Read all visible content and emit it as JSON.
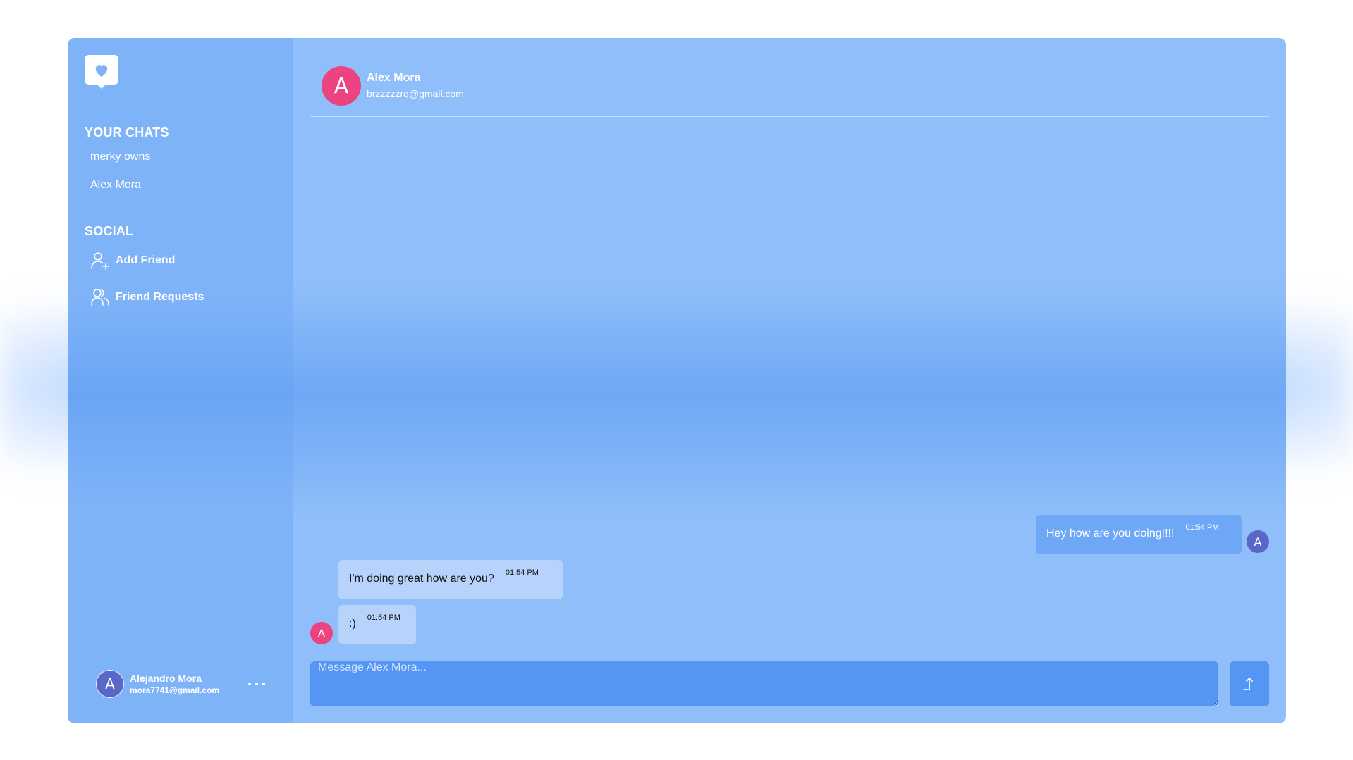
{
  "sidebar": {
    "chats_title": "YOUR CHATS",
    "chats": [
      {
        "label": "merky owns"
      },
      {
        "label": "Alex Mora"
      }
    ],
    "social_title": "SOCIAL",
    "social": [
      {
        "label": "Add Friend",
        "icon": "user-plus-icon"
      },
      {
        "label": "Friend Requests",
        "icon": "users-icon"
      }
    ],
    "profile": {
      "initial": "A",
      "name": "Alejandro Mora",
      "email": "mora7741@gmail.com"
    }
  },
  "chat": {
    "header": {
      "initial": "A",
      "name": "Alex Mora",
      "email": "brzzzzzrq@gmail.com"
    },
    "messages": [
      {
        "text": "Hey how are you doing!!!!",
        "time": "01:54 PM",
        "direction": "sent",
        "avatar": "A"
      },
      {
        "text": "I'm doing great how are you?",
        "time": "01:54 PM",
        "direction": "received"
      },
      {
        "text": ":)",
        "time": "01:54 PM",
        "direction": "received",
        "avatar": "A"
      }
    ],
    "composer_placeholder": "Message Alex Mora..."
  },
  "colors": {
    "accent": "#5595f4",
    "sent_bubble": "#6ea7f5",
    "received_bubble": "#b7d3fb",
    "contact_avatar": "#ec4381",
    "self_avatar": "#5a67c6"
  }
}
